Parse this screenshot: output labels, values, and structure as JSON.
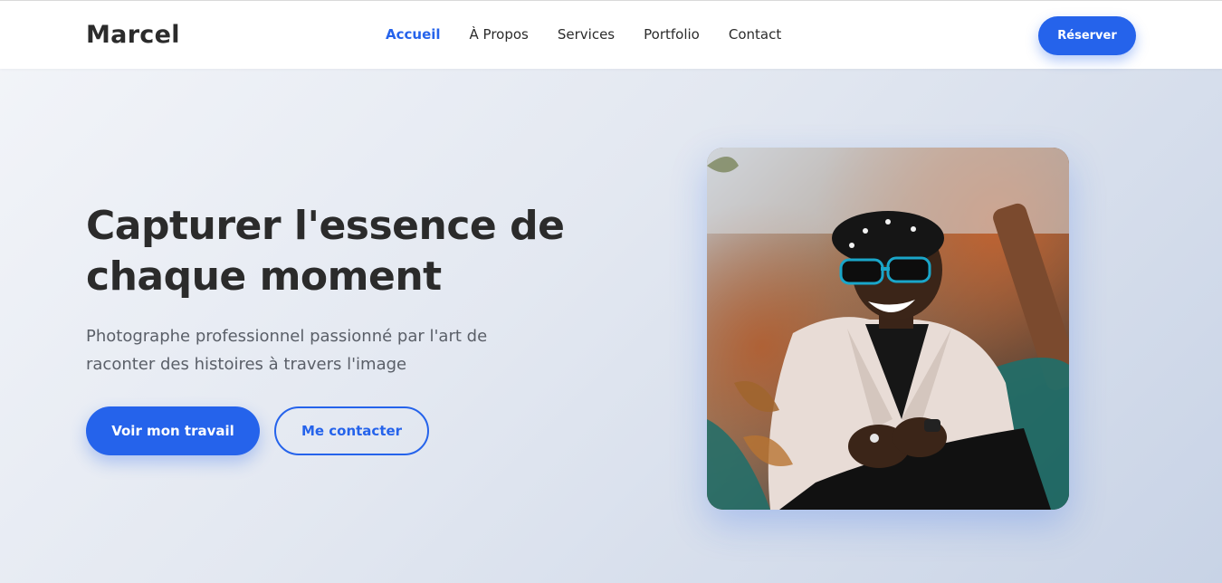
{
  "nav": {
    "logo": "Marcel",
    "links": [
      {
        "label": "Accueil",
        "active": true
      },
      {
        "label": "À Propos",
        "active": false
      },
      {
        "label": "Services",
        "active": false
      },
      {
        "label": "Portfolio",
        "active": false
      },
      {
        "label": "Contact",
        "active": false
      }
    ],
    "cta_label": "Réserver"
  },
  "hero": {
    "title": "Capturer l'essence de chaque moment",
    "subtitle": "Photographe professionnel passionné par l'art de raconter des histoires à travers l'image",
    "primary_button": "Voir mon travail",
    "secondary_button": "Me contacter"
  },
  "colors": {
    "accent": "#2563eb",
    "text": "#2b2b2b",
    "muted": "#5a5f68"
  }
}
